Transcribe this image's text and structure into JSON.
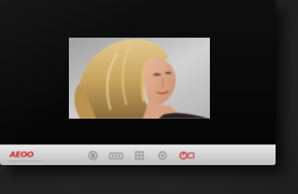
{
  "device": {
    "brand_label": "AEOO",
    "controls": [
      {
        "name": "menu-icon"
      },
      {
        "name": "wifi-icon"
      },
      {
        "name": "grid-icon"
      },
      {
        "name": "settings-icon"
      }
    ],
    "power": {
      "name": "power-icon",
      "color": "#d23a3a"
    }
  },
  "colors": {
    "brand": "#cc2a2a",
    "bezel": "#d4d4d4",
    "screen": "#0a0a0a"
  }
}
